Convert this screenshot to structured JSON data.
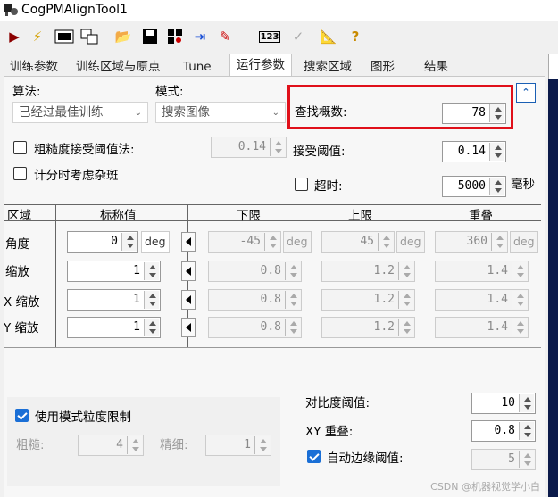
{
  "window": {
    "title": "CogPMAlignTool1"
  },
  "tabs": [
    "训练参数",
    "训练区域与原点",
    "Tune",
    "运行参数",
    "搜索区域",
    "图形",
    "结果"
  ],
  "algorithm": {
    "label": "算法:",
    "value": "已经过最佳训练"
  },
  "mode": {
    "label": "模式:",
    "value": "搜索图像"
  },
  "find_count": {
    "label": "查找概数:",
    "value": "78"
  },
  "coarse_accept": {
    "label": "粗糙度接受阈值法:",
    "value": "0.14"
  },
  "accept": {
    "label": "接受阈值:",
    "value": "0.14"
  },
  "timing_clutter": {
    "label": "计分时考虑杂斑"
  },
  "timeout": {
    "label": "超时:",
    "value": "5000",
    "unit": "毫秒"
  },
  "table": {
    "headers": [
      "区域",
      "标称值",
      "下限",
      "上限",
      "重叠"
    ],
    "rows": [
      {
        "label": "角度",
        "nominal": "0",
        "unit": "deg",
        "low": "-45",
        "high": "45",
        "overlap": "360",
        "has_unit": true
      },
      {
        "label": "缩放",
        "nominal": "1",
        "low": "0.8",
        "high": "1.2",
        "overlap": "1.4"
      },
      {
        "label": "X 缩放",
        "nominal": "1",
        "low": "0.8",
        "high": "1.2",
        "overlap": "1.4"
      },
      {
        "label": "Y 缩放",
        "nominal": "1",
        "low": "0.8",
        "high": "1.2",
        "overlap": "1.4"
      }
    ]
  },
  "granularity": {
    "label": "使用模式粒度限制",
    "coarse_label": "粗糙:",
    "coarse_value": "4",
    "fine_label": "精细:",
    "fine_value": "1"
  },
  "contrast": {
    "label": "对比度阈值:",
    "value": "10"
  },
  "xy_overlap": {
    "label": "XY 重叠:",
    "value": "0.8"
  },
  "auto_edge": {
    "label": "自动边缘阈值:",
    "value": "5"
  },
  "watermark": "CSDN @机器视觉学小白"
}
